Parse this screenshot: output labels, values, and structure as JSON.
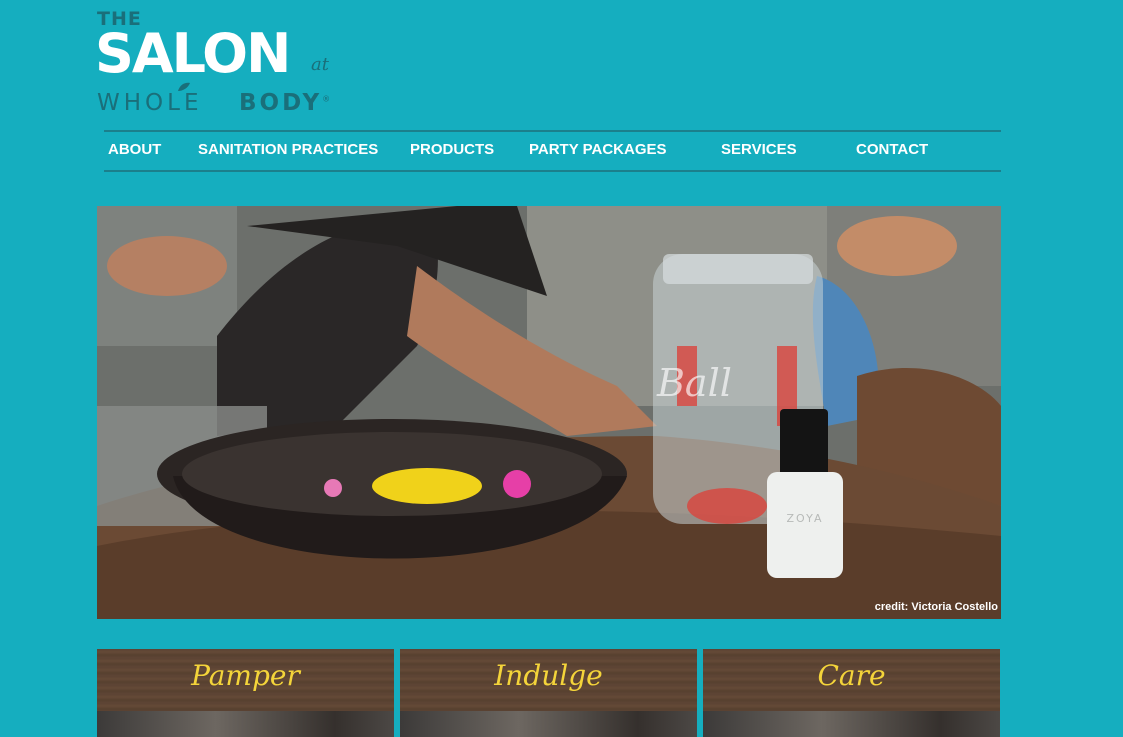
{
  "logo": {
    "the": "THE",
    "salon": "SALON",
    "at": "at",
    "whole": "WHOLE",
    "body": "BODY",
    "trademark": "®"
  },
  "nav": {
    "items": [
      {
        "label": "ABOUT"
      },
      {
        "label": "SANITATION PRACTICES"
      },
      {
        "label": "PRODUCTS"
      },
      {
        "label": "PARTY PACKAGES"
      },
      {
        "label": "SERVICES"
      },
      {
        "label": "CONTACT"
      }
    ]
  },
  "hero": {
    "credit": "credit: Victoria Costello",
    "jar_label": "Ball",
    "polish_label": "ZOYA"
  },
  "cards": [
    {
      "label": "Pamper"
    },
    {
      "label": "Indulge"
    },
    {
      "label": "Care"
    }
  ],
  "colors": {
    "background": "#15aebf",
    "logo_dark": "#1a6f7a",
    "nav_rule": "#1b7f8c",
    "card_label": "#f4d43a",
    "wood": "#5c4333"
  }
}
